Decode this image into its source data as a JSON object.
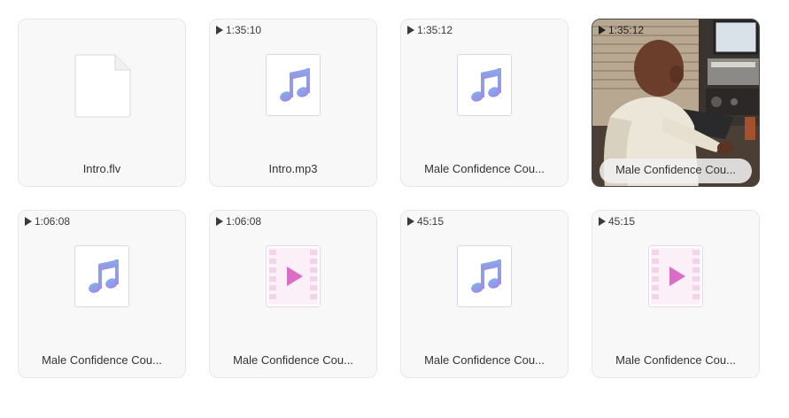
{
  "files": [
    {
      "name": "Intro.flv",
      "type": "generic",
      "duration": ""
    },
    {
      "name": "Intro.mp3",
      "type": "audio",
      "duration": "1:35:10"
    },
    {
      "name": "Male Confidence Cou...",
      "type": "audio",
      "duration": "1:35:12"
    },
    {
      "name": "Male Confidence Cou...",
      "type": "video-thumbnail",
      "duration": "1:35:12"
    },
    {
      "name": "Male Confidence Cou...",
      "type": "audio",
      "duration": "1:06:08"
    },
    {
      "name": "Male Confidence Cou...",
      "type": "video",
      "duration": "1:06:08"
    },
    {
      "name": "Male Confidence Cou...",
      "type": "audio",
      "duration": "45:15"
    },
    {
      "name": "Male Confidence Cou...",
      "type": "video",
      "duration": "45:15"
    }
  ],
  "icons": {
    "generic": "blank-file-icon",
    "audio": "music-note-icon",
    "video": "video-film-icon",
    "duration": "play-icon"
  },
  "colors": {
    "card_bg": "#f8f8f9",
    "card_border": "#e6e6ea",
    "audio_note": "#8e95e8",
    "video_play": "#d96fc4",
    "video_film": "#f4dcef"
  }
}
